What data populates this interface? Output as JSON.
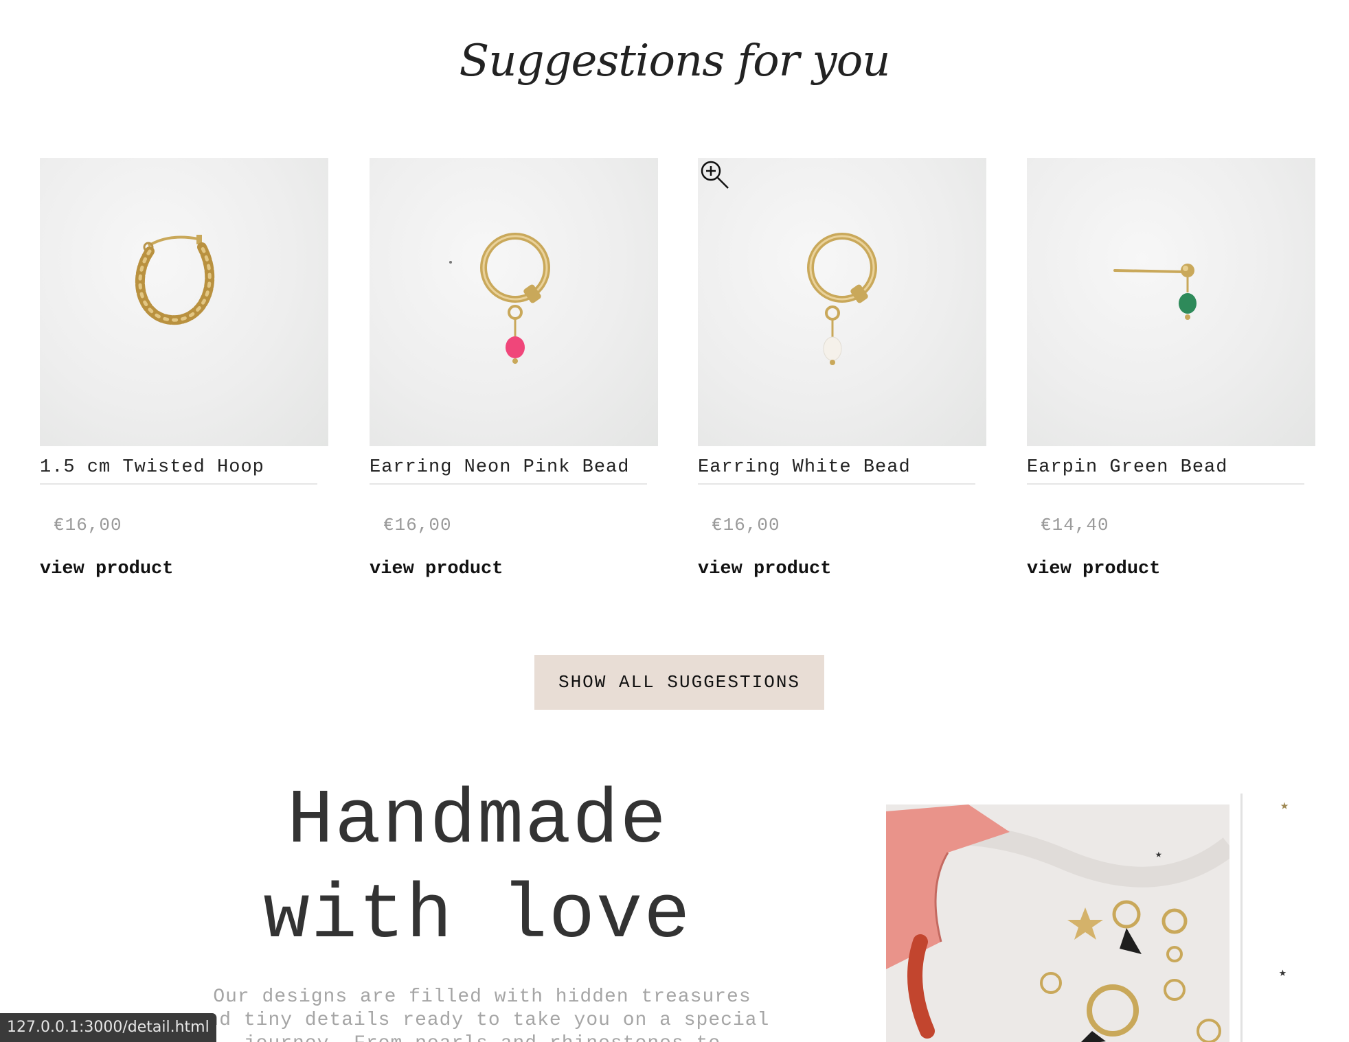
{
  "suggestions": {
    "title": "Suggestions for you",
    "products": [
      {
        "name": "1.5 cm Twisted Hoop",
        "price": "€16,00",
        "link_label": "view product"
      },
      {
        "name": "Earring Neon Pink Bead",
        "price": "€16,00",
        "link_label": "view product"
      },
      {
        "name": "Earring White Bead",
        "price": "€16,00",
        "link_label": "view product"
      },
      {
        "name": "Earpin Green Bead",
        "price": "€14,40",
        "link_label": "view product"
      }
    ],
    "show_all_label": "SHOW ALL SUGGESTIONS"
  },
  "handmade": {
    "title_line1": "Handmade",
    "title_line2": "with love",
    "text_line1": "Our designs are filled with hidden treasures",
    "text_line2": "and tiny details ready to take you on a special",
    "text_line3": "journey. From pearls and rhinestones to"
  },
  "status_bar": {
    "url": "127.0.0.1:3000/detail.html"
  },
  "colors": {
    "button_bg": "#e8ddd5",
    "price_text": "#9a9a9a",
    "gold": "#c9a85a",
    "neon_pink_bead": "#f0467a",
    "white_bead": "#f5f1ea",
    "green_bead": "#2e8a5a"
  },
  "icons": {
    "zoom": "zoom-in-icon",
    "star": "star-icon"
  }
}
